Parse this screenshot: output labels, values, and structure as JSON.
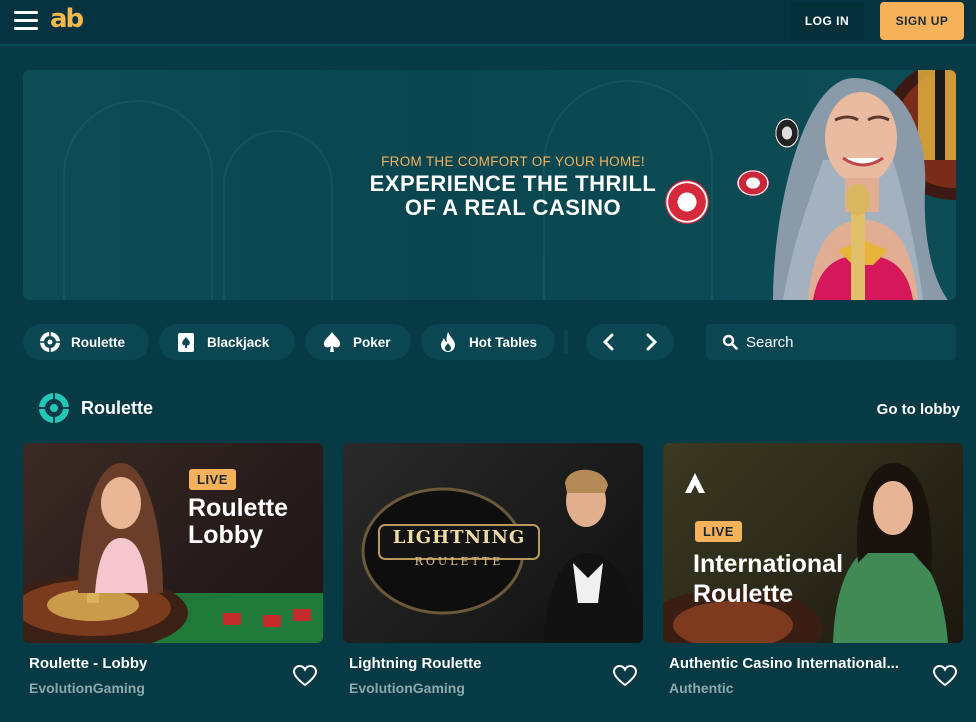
{
  "header": {
    "login_label": "LOG IN",
    "signup_label": "SIGN UP",
    "logo_text": "ab"
  },
  "banner": {
    "subtitle": "FROM THE COMFORT OF YOUR HOME!",
    "title": "EXPERIENCE THE THRILL\nOF A REAL CASINO"
  },
  "categories": [
    {
      "label": "Roulette",
      "icon": "roulette-wheel-icon"
    },
    {
      "label": "Blackjack",
      "icon": "playing-card-icon"
    },
    {
      "label": "Poker",
      "icon": "spade-icon"
    },
    {
      "label": "Hot Tables",
      "icon": "flame-icon"
    }
  ],
  "search": {
    "placeholder": "Search"
  },
  "section": {
    "title": "Roulette",
    "link_label": "Go to lobby"
  },
  "games": [
    {
      "name": "Roulette - Lobby",
      "provider": "EvolutionGaming",
      "badge": "LIVE",
      "overlay_title": "Roulette\nLobby"
    },
    {
      "name": "Lightning Roulette",
      "provider": "EvolutionGaming",
      "logo_top": "LIGHTNING",
      "logo_bottom": "ROULETTE"
    },
    {
      "name": "Authentic Casino International...",
      "provider": "Authentic",
      "badge": "LIVE",
      "overlay_title": "International\nRoulette"
    }
  ],
  "colors": {
    "background": "#063a44",
    "accent": "#f5b25a",
    "chip_bg": "#0a4752",
    "teal_icon": "#22c7b8"
  }
}
